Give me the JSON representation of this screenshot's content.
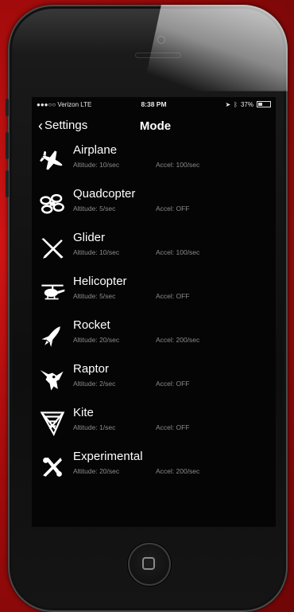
{
  "status_bar": {
    "carrier": "●●●○○ Verizon  LTE",
    "time": "8:38 PM",
    "battery": "37%",
    "battery_level": 0.37
  },
  "navbar": {
    "back_label": "Settings",
    "title": "Mode"
  },
  "modes": [
    {
      "name": "Airplane",
      "icon": "airplane-icon",
      "altitude": "Altitude: 10/sec",
      "accel": "Accel: 100/sec"
    },
    {
      "name": "Quadcopter",
      "icon": "quadcopter-icon",
      "altitude": "Altitude: 5/sec",
      "accel": "Accel: OFF"
    },
    {
      "name": "Glider",
      "icon": "glider-icon",
      "altitude": "Altitude: 10/sec",
      "accel": "Accel: 100/sec"
    },
    {
      "name": "Helicopter",
      "icon": "helicopter-icon",
      "altitude": "Altitude: 5/sec",
      "accel": "Accel: OFF"
    },
    {
      "name": "Rocket",
      "icon": "rocket-icon",
      "altitude": "Altitude: 20/sec",
      "accel": "Accel: 200/sec"
    },
    {
      "name": "Raptor",
      "icon": "raptor-icon",
      "altitude": "Altitude: 2/sec",
      "accel": "Accel: OFF"
    },
    {
      "name": "Kite",
      "icon": "kite-icon",
      "altitude": "Altitude: 1/sec",
      "accel": "Accel: OFF"
    },
    {
      "name": "Experimental",
      "icon": "experimental-icon",
      "altitude": "Altitude: 20/sec",
      "accel": "Accel: 200/sec"
    }
  ],
  "colors": {
    "background": "#b80f0f",
    "screen": "#050505",
    "text": "#ffffff",
    "subtext": "#8a8a8a"
  }
}
